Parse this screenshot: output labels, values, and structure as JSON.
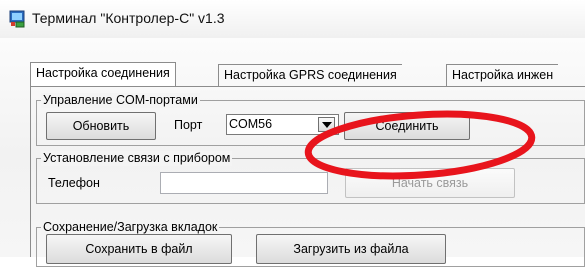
{
  "window": {
    "title": "Терминал \"Контролер-С\" v1.3"
  },
  "tabs": [
    {
      "label": "Настройка соединения"
    },
    {
      "label": "Настройка GPRS соединения"
    },
    {
      "label": "Настройка инжен"
    }
  ],
  "com_group": {
    "legend": "Управление COM-портами",
    "refresh_label": "Обновить",
    "port_label": "Порт",
    "port_value": "COM56",
    "connect_label": "Соединить"
  },
  "link_group": {
    "legend": "Установление связи с прибором",
    "phone_label": "Телефон",
    "phone_value": "",
    "start_label": "Начать связь"
  },
  "save_group": {
    "legend": "Сохранение/Загрузка вкладок",
    "save_label": "Сохранить в файл",
    "load_label": "Загрузить из файла"
  },
  "annotation": {
    "color": "#e8141c"
  }
}
